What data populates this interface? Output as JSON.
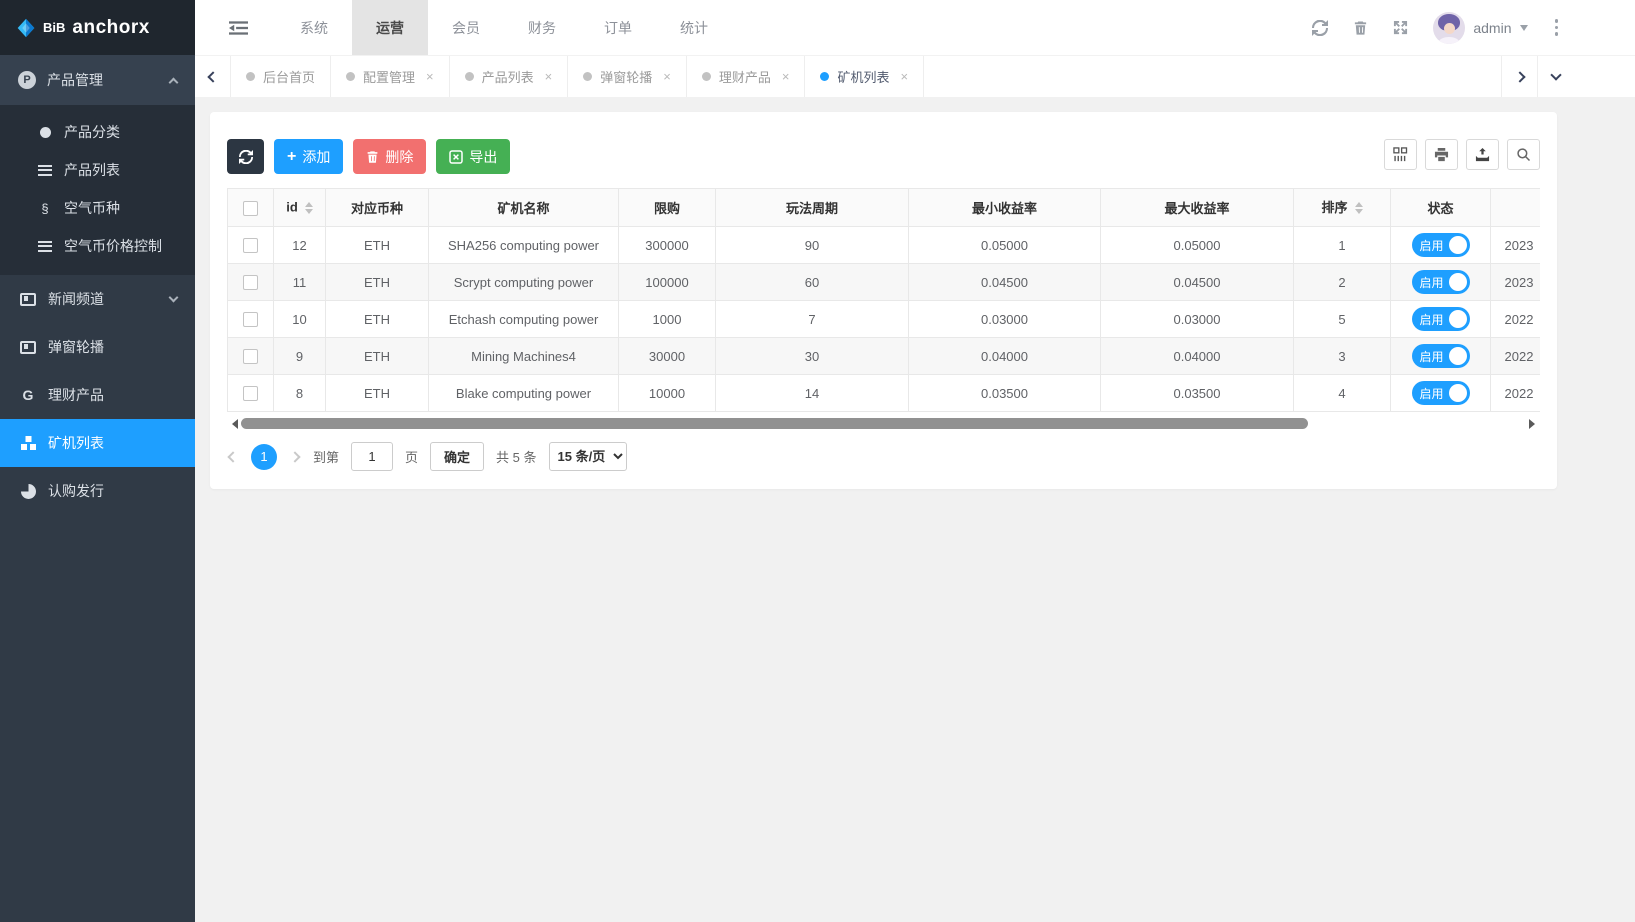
{
  "logo": {
    "brand_short": "BiB",
    "brand_name": "anchorx"
  },
  "topnav": {
    "items": [
      {
        "label": "系统",
        "active": false
      },
      {
        "label": "运营",
        "active": true
      },
      {
        "label": "会员",
        "active": false
      },
      {
        "label": "财务",
        "active": false
      },
      {
        "label": "订单",
        "active": false
      },
      {
        "label": "统计",
        "active": false
      }
    ],
    "username": "admin"
  },
  "tabs": {
    "close_glyph": "×",
    "items": [
      {
        "label": "后台首页",
        "active": false,
        "closable": false
      },
      {
        "label": "配置管理",
        "active": false,
        "closable": true
      },
      {
        "label": "产品列表",
        "active": false,
        "closable": true
      },
      {
        "label": "弹窗轮播",
        "active": false,
        "closable": true
      },
      {
        "label": "理财产品",
        "active": false,
        "closable": true
      },
      {
        "label": "矿机列表",
        "active": true,
        "closable": true
      }
    ]
  },
  "sidebar": {
    "parent": {
      "label": "产品管理",
      "icon": "P"
    },
    "submenu": [
      {
        "label": "产品分类"
      },
      {
        "label": "产品列表"
      },
      {
        "label": "空气币种",
        "glyph": "§"
      },
      {
        "label": "空气币价格控制"
      }
    ],
    "items": [
      {
        "label": "新闻频道"
      },
      {
        "label": "弹窗轮播"
      },
      {
        "label": "理财产品",
        "glyph": "G"
      },
      {
        "label": "矿机列表"
      },
      {
        "label": "认购发行"
      }
    ]
  },
  "toolbar": {
    "add_label": "添加",
    "delete_label": "删除",
    "export_label": "导出"
  },
  "table": {
    "columns": {
      "id": "id",
      "coin": "对应币种",
      "name": "矿机名称",
      "limit": "限购",
      "cycle": "玩法周期",
      "min_rate": "最小收益率",
      "max_rate": "最大收益率",
      "sort": "排序",
      "status": "状态",
      "created": ""
    },
    "rows": [
      {
        "id": "12",
        "coin": "ETH",
        "name": "SHA256 computing power",
        "limit": "300000",
        "cycle": "90",
        "min_rate": "0.05000",
        "max_rate": "0.05000",
        "sort": "1",
        "status": "启用",
        "created": "2023"
      },
      {
        "id": "11",
        "coin": "ETH",
        "name": "Scrypt computing power",
        "limit": "100000",
        "cycle": "60",
        "min_rate": "0.04500",
        "max_rate": "0.04500",
        "sort": "2",
        "status": "启用",
        "created": "2023"
      },
      {
        "id": "10",
        "coin": "ETH",
        "name": "Etchash computing power",
        "limit": "1000",
        "cycle": "7",
        "min_rate": "0.03000",
        "max_rate": "0.03000",
        "sort": "5",
        "status": "启用",
        "created": "2022"
      },
      {
        "id": "9",
        "coin": "ETH",
        "name": "Mining Machines4",
        "limit": "30000",
        "cycle": "30",
        "min_rate": "0.04000",
        "max_rate": "0.04000",
        "sort": "3",
        "status": "启用",
        "created": "2022"
      },
      {
        "id": "8",
        "coin": "ETH",
        "name": "Blake computing power",
        "limit": "10000",
        "cycle": "14",
        "min_rate": "0.03500",
        "max_rate": "0.03500",
        "sort": "4",
        "status": "启用",
        "created": "2022"
      }
    ]
  },
  "pagination": {
    "current_page": "1",
    "jump_prefix": "到第",
    "jump_value": "1",
    "jump_suffix": "页",
    "confirm_label": "确定",
    "total_label": "共 5 条",
    "page_size_label": "15 条/页"
  },
  "colors": {
    "primary": "#1E9FFF",
    "danger": "#f2706f",
    "success": "#45b054",
    "dark_button": "#2c3642",
    "sidebar_bg": "#303a46",
    "sidebar_active": "#1E9FFF"
  }
}
